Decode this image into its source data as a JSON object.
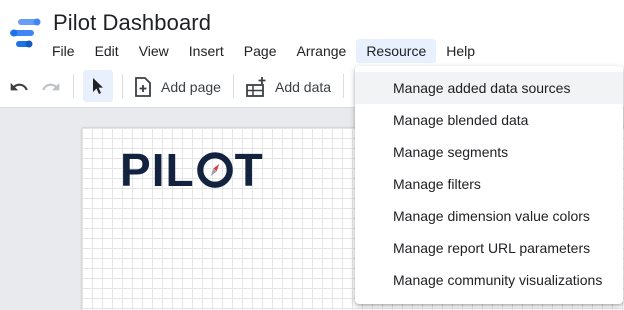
{
  "app": {
    "title": "Pilot Dashboard"
  },
  "menu": [
    "File",
    "Edit",
    "View",
    "Insert",
    "Page",
    "Arrange",
    "Resource",
    "Help"
  ],
  "toolbar": {
    "add_page_label": "Add page",
    "add_data_label": "Add data"
  },
  "canvas": {
    "logo_text": [
      "P",
      "I",
      "L",
      "T"
    ]
  },
  "resource_menu": {
    "items": [
      "Manage added data sources",
      "Manage blended data",
      "Manage segments",
      "Manage filters",
      "Manage dimension value colors",
      "Manage report URL parameters",
      "Manage community visualizations"
    ]
  },
  "colors": {
    "accent": "#4285f4",
    "logo": "#13233f",
    "logo_accent": "#e63946",
    "menu_active": "#e8f0fe"
  },
  "icons": [
    "datastudio-logo-icon",
    "undo-icon",
    "redo-icon",
    "select-cursor-icon",
    "add-page-icon",
    "add-data-icon",
    "compass-icon"
  ]
}
